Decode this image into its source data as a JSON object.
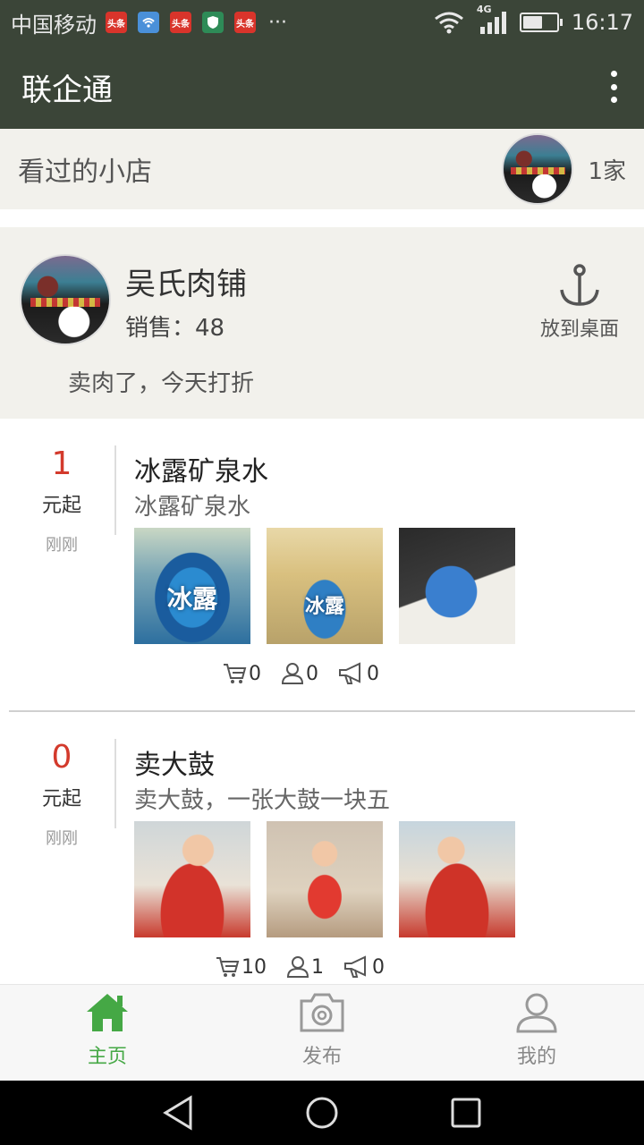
{
  "status_bar": {
    "carrier": "中国移动",
    "notification_icons": [
      "头条",
      "",
      "头条",
      "",
      "头条"
    ],
    "more": "···",
    "network": "4G",
    "time": "16:17",
    "battery_level": 0.6
  },
  "app_bar": {
    "title": "联企通"
  },
  "viewed_shops": {
    "label": "看过的小店",
    "count": "1家"
  },
  "shop": {
    "name": "吴氏肉铺",
    "sales": "销售：48",
    "description": "卖肉了，今天打折",
    "pin_label": "放到桌面"
  },
  "products": [
    {
      "price": "1",
      "unit": "元起",
      "time": "刚刚",
      "title": "冰露矿泉水",
      "subtitle": "冰露矿泉水",
      "thumb_labels": [
        "冰露",
        "冰露",
        ""
      ],
      "stats": {
        "cart": "0",
        "users": "0",
        "shares": "0"
      }
    },
    {
      "price": "0",
      "unit": "元起",
      "time": "刚刚",
      "title": "卖大鼓",
      "subtitle": "卖大鼓，一张大鼓一块五",
      "thumb_labels": [
        "",
        "",
        ""
      ],
      "stats": {
        "cart": "10",
        "users": "1",
        "shares": "0"
      }
    }
  ],
  "bottom_nav": [
    {
      "label": "主页",
      "icon": "home-icon",
      "active": true
    },
    {
      "label": "发布",
      "icon": "camera-icon",
      "active": false
    },
    {
      "label": "我的",
      "icon": "user-icon",
      "active": false
    }
  ],
  "colors": {
    "primary_dark": "#3b4538",
    "accent_green": "#45a845",
    "price_red": "#d33a2c",
    "card_bg": "#f2f1ec"
  }
}
